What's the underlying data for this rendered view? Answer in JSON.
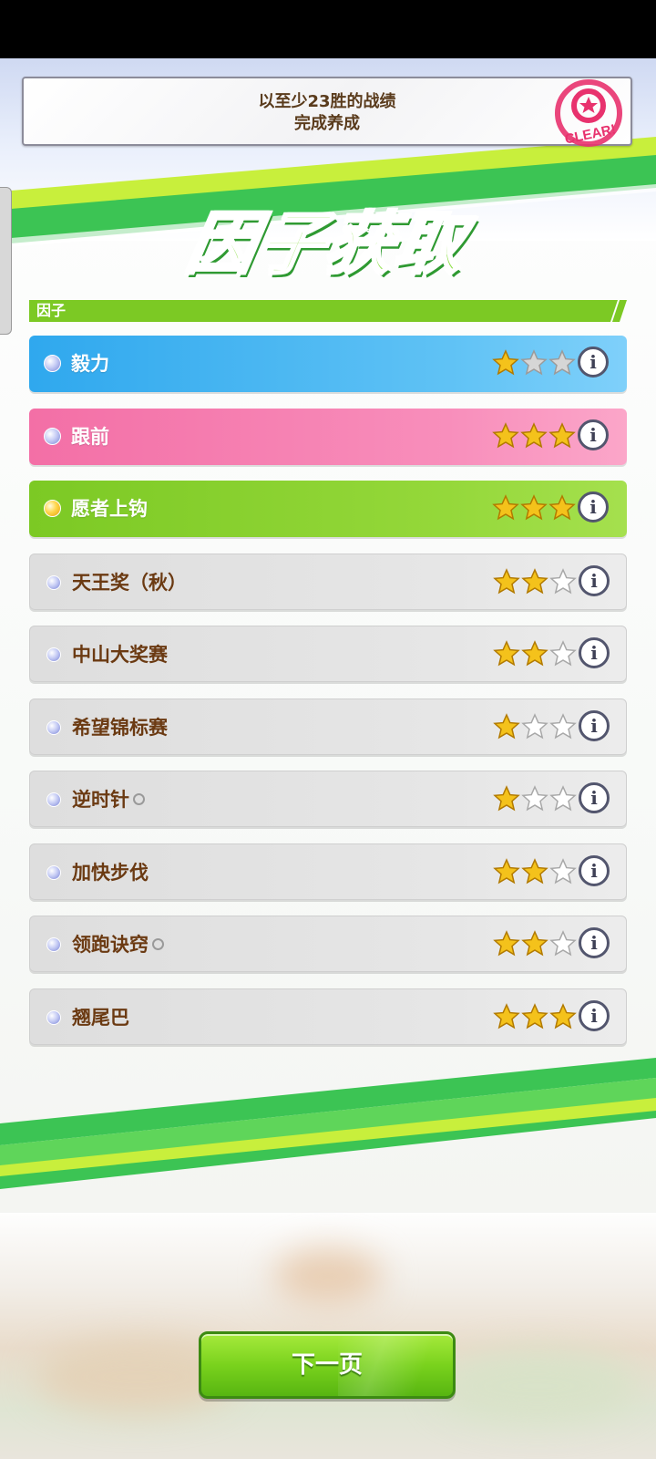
{
  "mission": {
    "line1": "以至少23胜的战绩",
    "line2": "完成养成",
    "stamp_text": "CLEAR!"
  },
  "title": "因子获取",
  "section": {
    "label": "因子"
  },
  "colors": {
    "blue_row": "#2fa8ee",
    "pink_row": "#f36fa6",
    "green_row": "#7cc924",
    "gray_row": "#dedede",
    "name_brown": "#6b3a12",
    "star_gold": "#f4c21b",
    "button_green": "#7ad21d"
  },
  "factors": [
    {
      "name": "毅力",
      "color": "blue",
      "gem": "blue",
      "stars": 1,
      "suffix": false,
      "icon": "info-icon"
    },
    {
      "name": "跟前",
      "color": "pink",
      "gem": "blue",
      "stars": 3,
      "suffix": false,
      "icon": "info-icon"
    },
    {
      "name": "愿者上钩",
      "color": "green",
      "gem": "gold",
      "stars": 3,
      "suffix": false,
      "icon": "info-icon"
    },
    {
      "name": "天王奖（秋）",
      "color": "gray",
      "gem": "blue",
      "stars": 2,
      "suffix": false,
      "icon": "info-icon"
    },
    {
      "name": "中山大奖赛",
      "color": "gray",
      "gem": "blue",
      "stars": 2,
      "suffix": false,
      "icon": "info-icon"
    },
    {
      "name": "希望锦标赛",
      "color": "gray",
      "gem": "blue",
      "stars": 1,
      "suffix": false,
      "icon": "info-icon"
    },
    {
      "name": "逆时针",
      "color": "gray",
      "gem": "blue",
      "stars": 1,
      "suffix": true,
      "icon": "info-icon"
    },
    {
      "name": "加快步伐",
      "color": "gray",
      "gem": "blue",
      "stars": 2,
      "suffix": false,
      "icon": "info-icon"
    },
    {
      "name": "领跑诀窍",
      "color": "gray",
      "gem": "blue",
      "stars": 2,
      "suffix": true,
      "icon": "info-icon"
    },
    {
      "name": "翘尾巴",
      "color": "gray",
      "gem": "blue",
      "stars": 3,
      "suffix": false,
      "icon": "info-icon"
    }
  ],
  "max_stars": 3,
  "next_button": {
    "label": "下一页"
  }
}
